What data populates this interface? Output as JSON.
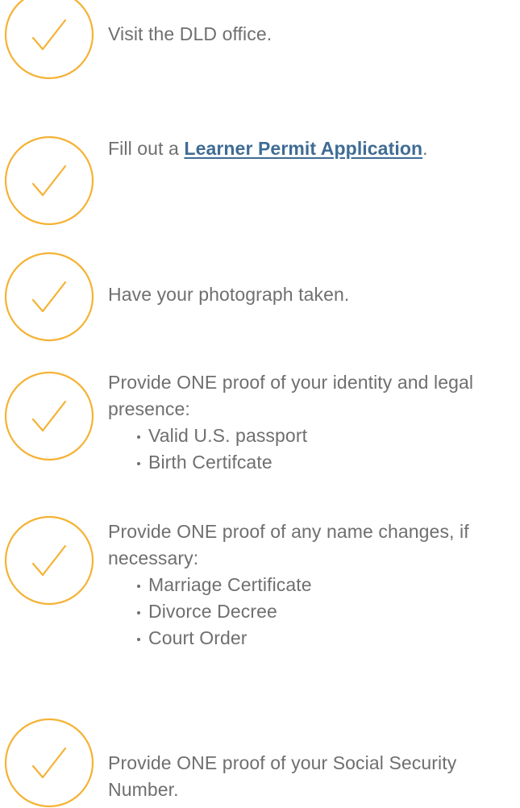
{
  "checklist": {
    "icon": "check-circle-icon",
    "accent_color": "#f5b234",
    "text_color": "#6f6f6f",
    "link_color": "#3f6c95",
    "steps": [
      {
        "text": "Visit the DLD office."
      },
      {
        "prefix": "Fill out a ",
        "link": "Learner Permit Application",
        "suffix": "."
      },
      {
        "text": "Have your photograph taken."
      },
      {
        "text": "Provide ONE proof of your identity and legal presence:",
        "bullets": [
          "Valid U.S. passport",
          "Birth Certifcate"
        ]
      },
      {
        "text": "Provide ONE proof of any name changes, if necessary:",
        "bullets": [
          "Marriage Certificate",
          "Divorce Decree",
          "Court Order"
        ]
      },
      {
        "text": "Provide ONE proof of your Social Security Number."
      }
    ]
  }
}
